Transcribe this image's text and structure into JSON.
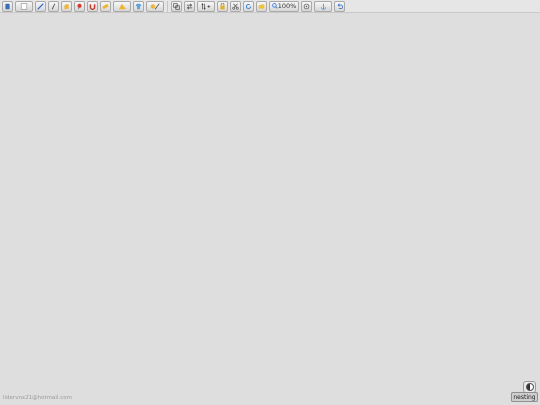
{
  "toolbar": {
    "zoom_level": "100%",
    "tools": [
      {
        "icon": "pointer-icon",
        "color": "#3b6fb6"
      },
      {
        "icon": "panel-icon",
        "color": "#ffffff"
      },
      {
        "icon": "pen-icon",
        "color": "#2a63c9"
      },
      {
        "icon": "line-icon",
        "color": "#333333"
      },
      {
        "icon": "hand-icon",
        "color": "#f3b436"
      },
      {
        "icon": "pin-icon",
        "color": "#d33b2c"
      },
      {
        "icon": "magnet-icon",
        "color": "#c0392b"
      },
      {
        "icon": "ruler-icon",
        "color": "#f0b429"
      },
      {
        "icon": "angle-ruler-icon",
        "color": "#f0b429"
      },
      {
        "icon": "tshirt-icon",
        "color": "#5aa0de"
      },
      {
        "icon": "measure-icon",
        "color": "#f0b429"
      },
      {
        "icon": "copy-icon",
        "color": "#444444"
      },
      {
        "icon": "swap-icon",
        "color": "#444444"
      },
      {
        "icon": "sort-add-icon",
        "color": "#444444"
      },
      {
        "icon": "lock-icon",
        "color": "#e4b121"
      },
      {
        "icon": "scissors-icon",
        "color": "#555555"
      },
      {
        "icon": "rotate-icon",
        "color": "#2f7fd1"
      },
      {
        "icon": "folder-icon",
        "color": "#f1c232"
      },
      {
        "icon": "magnifier-icon",
        "color": "#3d7bd6"
      },
      {
        "icon": "target-icon",
        "color": "#555555"
      },
      {
        "icon": "anchor-icon",
        "color": "#4a8fd8"
      },
      {
        "icon": "undo-icon",
        "color": "#3a78c9"
      }
    ]
  },
  "footer": {
    "user_email": "lidervnx21@hotmail.com",
    "nesting_label": "nesting"
  }
}
